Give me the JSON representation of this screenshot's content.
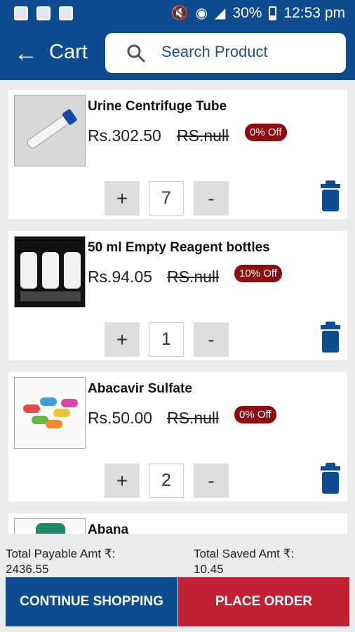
{
  "status_bar": {
    "battery": "30%",
    "time": "12:53 pm"
  },
  "header": {
    "title": "Cart",
    "search_placeholder": "Search Product"
  },
  "cart": {
    "items": [
      {
        "name": "Urine Centrifuge Tube",
        "price": "Rs.302.50",
        "mrp": "RS.null",
        "discount": "0% Off",
        "quantity": "7"
      },
      {
        "name": "50 ml Empty Reagent bottles",
        "price": "Rs.94.05",
        "mrp": "RS.null",
        "discount": "10% Off",
        "quantity": "1"
      },
      {
        "name": "Abacavir Sulfate",
        "price": "Rs.50.00",
        "mrp": "RS.null",
        "discount": "0% Off",
        "quantity": "2"
      },
      {
        "name": "Abana"
      }
    ],
    "increment_label": "+",
    "decrement_label": "-"
  },
  "totals": {
    "payable_label": "Total Payable Amt ₹:",
    "payable_value": "2436.55",
    "saved_label": "Total Saved Amt ₹:",
    "saved_value": "10.45"
  },
  "actions": {
    "continue_shopping": "CONTINUE SHOPPING",
    "place_order": "PLACE ORDER"
  },
  "colors": {
    "primary": "#0d4d8f",
    "danger": "#c02233",
    "badge": "#8b0e12"
  }
}
